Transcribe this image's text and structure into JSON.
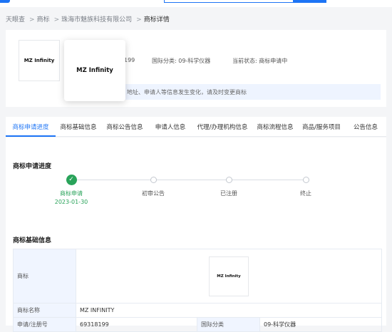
{
  "breadcrumb": {
    "items": [
      "天眼查",
      "商标",
      "珠海市魅族科技有限公司"
    ],
    "current": "商标详情",
    "separator": ">"
  },
  "header": {
    "logo_text": "MZ Infinity",
    "reg_no_partial": "199",
    "intl_class": "国际分类: 09-科学仪器",
    "status": "当前状态: 商标申请中",
    "notice": "地址、申请人等信息发生变化，请及时变更商标"
  },
  "tabs": [
    {
      "label": "商标申请进度",
      "active": true
    },
    {
      "label": "商标基础信息",
      "active": false
    },
    {
      "label": "商标公告信息",
      "active": false
    },
    {
      "label": "申请人信息",
      "active": false
    },
    {
      "label": "代理/办理机构信息",
      "active": false
    },
    {
      "label": "商标流程信息",
      "active": false
    },
    {
      "label": "商品/服务项目",
      "active": false
    },
    {
      "label": "公告信息",
      "active": false
    }
  ],
  "progress": {
    "title": "商标申请进度",
    "steps": [
      {
        "label": "商标申请",
        "date": "2023-01-30",
        "done": true
      },
      {
        "label": "初审公告",
        "date": "",
        "done": false
      },
      {
        "label": "已注册",
        "date": "",
        "done": false
      },
      {
        "label": "终止",
        "date": "",
        "done": false
      }
    ],
    "check_glyph": "✓"
  },
  "basic_info": {
    "title": "商标基础信息",
    "rows": {
      "logo_label": "商标",
      "logo_text": "MZ Infinity",
      "name_label": "商标名称",
      "name_value": "MZ INFINITY",
      "reg_label": "申请/注册号",
      "reg_value": "69318199",
      "class_label": "国际分类",
      "class_value": "09-科学仪器"
    }
  },
  "colors": {
    "accent": "#1d74f5",
    "success": "#29a35a",
    "table_header_bg": "#f0f5ff"
  }
}
